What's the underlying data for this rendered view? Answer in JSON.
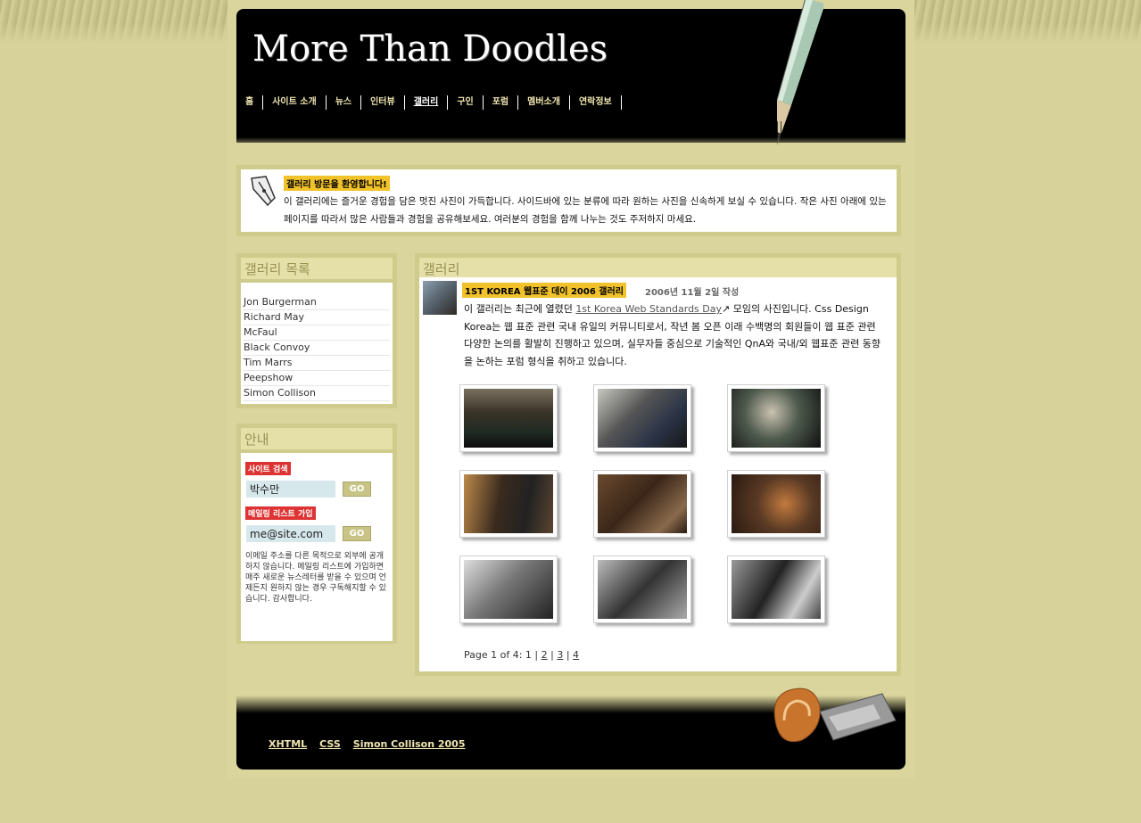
{
  "site": {
    "title": "More Than Doodles"
  },
  "nav": [
    {
      "label": "홈"
    },
    {
      "label": "사이트 소개"
    },
    {
      "label": "뉴스"
    },
    {
      "label": "인터뷰"
    },
    {
      "label": "갤러리"
    },
    {
      "label": "구인"
    },
    {
      "label": "포럼"
    },
    {
      "label": "멤버소개"
    },
    {
      "label": "연락정보"
    }
  ],
  "intro": {
    "title": "갤러리 방문을 환영합니다!",
    "text": "이 갤러리에는 즐거운 경험을 담은 멋진 사진이 가득합니다. 사이드바에 있는 분류에 따라 원하는 사진을 신속하게 보실 수 있습니다. 작은 사진 아래에 있는 페이지를 따라서 많은 사람들과 경험을 공유해보세요. 여러분의 경험을 함께 나누는 것도 주저하지 마세요."
  },
  "gallery_list": {
    "heading": "갤러리 목록",
    "items": [
      "Jon Burgerman",
      "Richard May",
      "McFaul",
      "Black Convoy",
      "Tim Marrs",
      "Peepshow",
      "Simon Collison"
    ]
  },
  "info": {
    "heading": "안내",
    "search_label": "사이트 검색",
    "search_value": "박수만",
    "mailing_label": "메일링 리스트 가입",
    "email_placeholder": "me@site.com",
    "go_label": "GO",
    "note": "이메일 주소를 다른 목적으로 외부에 공개하지 않습니다. 메일링 리스트에 가입하면 매주 새로운 뉴스레터를 받을 수 있으며 언제든지 원하지 않는 경우 구독해지할 수 있습니다. 감사합니다."
  },
  "main": {
    "heading": "갤러리",
    "post_title": "1ST KOREA 웹표준 데이 2006 갤러리",
    "post_date": "2006년 11월 2일 작성",
    "post_text_1": "이 갤러리는 최근에 열렸던 ",
    "post_link": "1st Korea Web Standards Day",
    "post_text_2": " 모임의 사진입니다. Css Design Korea는 웹 표준 관련 국내 유일의 커뮤니티로서, 작년 봄 오픈 이래 수백명의 회원들이 웹 표준 관련 다양한 논의를 활발히 진행하고 있으며, 실무자들 중심으로 기술적인 QnA와 국내/외 웹표준 관련 동향을 논하는 포럼 형식을 취하고 있습니다.",
    "pager_text": "Page 1 of 4: 1 |",
    "pages": [
      "2",
      "3",
      "4"
    ]
  },
  "footer": {
    "links": [
      "XHTML",
      "CSS",
      "Simon Collison 2005"
    ]
  },
  "colors": {
    "background": "#d6d29a",
    "header": "#000000",
    "accent_yellow": "#f2c22a",
    "label_red": "#dd3333"
  }
}
